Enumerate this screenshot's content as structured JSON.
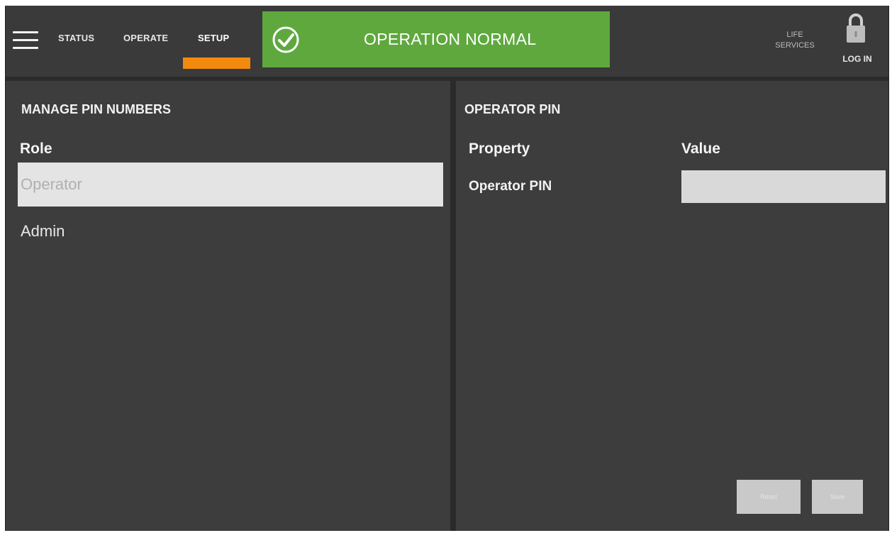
{
  "nav": {
    "tabs": [
      {
        "label": "STATUS"
      },
      {
        "label": "OPERATE"
      },
      {
        "label": "SETUP"
      }
    ],
    "active_tab": "SETUP",
    "life_services": "LIFE SERVICES",
    "login": "LOG IN"
  },
  "status": {
    "text": "OPERATION NORMAL",
    "color": "#5fa83e"
  },
  "accent_color": "#f28a0d",
  "left": {
    "title": "MANAGE PIN NUMBERS",
    "column_header": "Role",
    "roles": [
      "Operator",
      "Admin"
    ],
    "selected_role": "Operator"
  },
  "right": {
    "title": "OPERATOR PIN",
    "headers": {
      "property": "Property",
      "value": "Value"
    },
    "rows": [
      {
        "property": "Operator PIN",
        "value": ""
      }
    ],
    "buttons": {
      "primary": "Reset",
      "secondary": "Save"
    }
  },
  "icons": [
    "menu-icon",
    "check-circle-icon",
    "lock-icon"
  ]
}
